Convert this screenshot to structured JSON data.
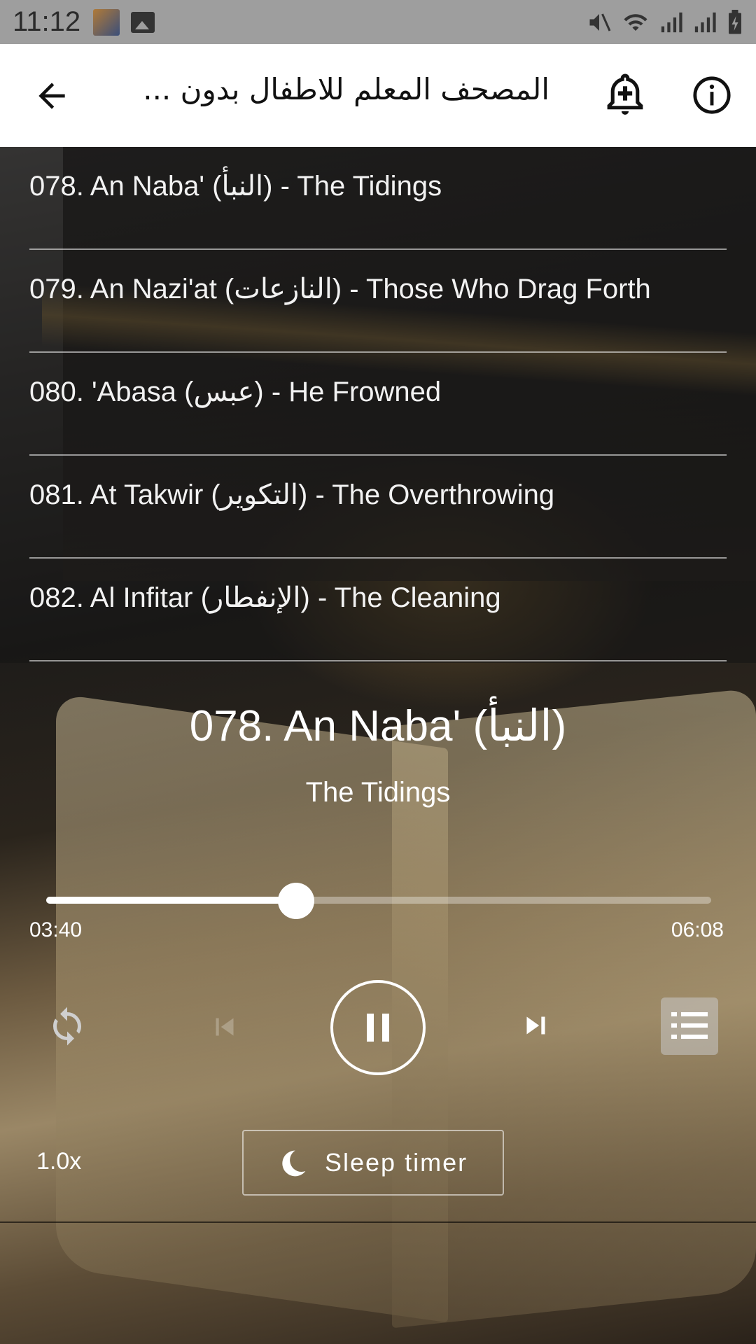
{
  "status_bar": {
    "time": "11:12",
    "icons": [
      "app-thumbnail-icon",
      "image-icon",
      "mute-icon",
      "wifi-icon",
      "signal-icon",
      "roaming-signal-icon",
      "battery-charging-icon"
    ]
  },
  "app_bar": {
    "title": "المصحف المعلم للاطفال بدون ...",
    "back_icon": "arrow-left-icon",
    "bell_icon": "add-alarm-bell-icon",
    "info_icon": "info-icon"
  },
  "tracks": [
    {
      "label": "078. An Naba' (النبأ) - The Tidings"
    },
    {
      "label": "079. An Nazi'at (النازعات) - Those Who Drag Forth"
    },
    {
      "label": "080. 'Abasa (عبس) - He Frowned"
    },
    {
      "label": "081. At Takwir (التكوير) - The Overthrowing"
    },
    {
      "label": "082. Al Infitar (الإنفطار) - The Cleaning"
    }
  ],
  "player": {
    "title": "078. An Naba' (النبأ)",
    "subtitle": "The Tidings",
    "elapsed": "03:40",
    "total": "06:08",
    "progress": 0.376,
    "speed": "1.0x",
    "sleep_timer_label": "Sleep timer"
  }
}
